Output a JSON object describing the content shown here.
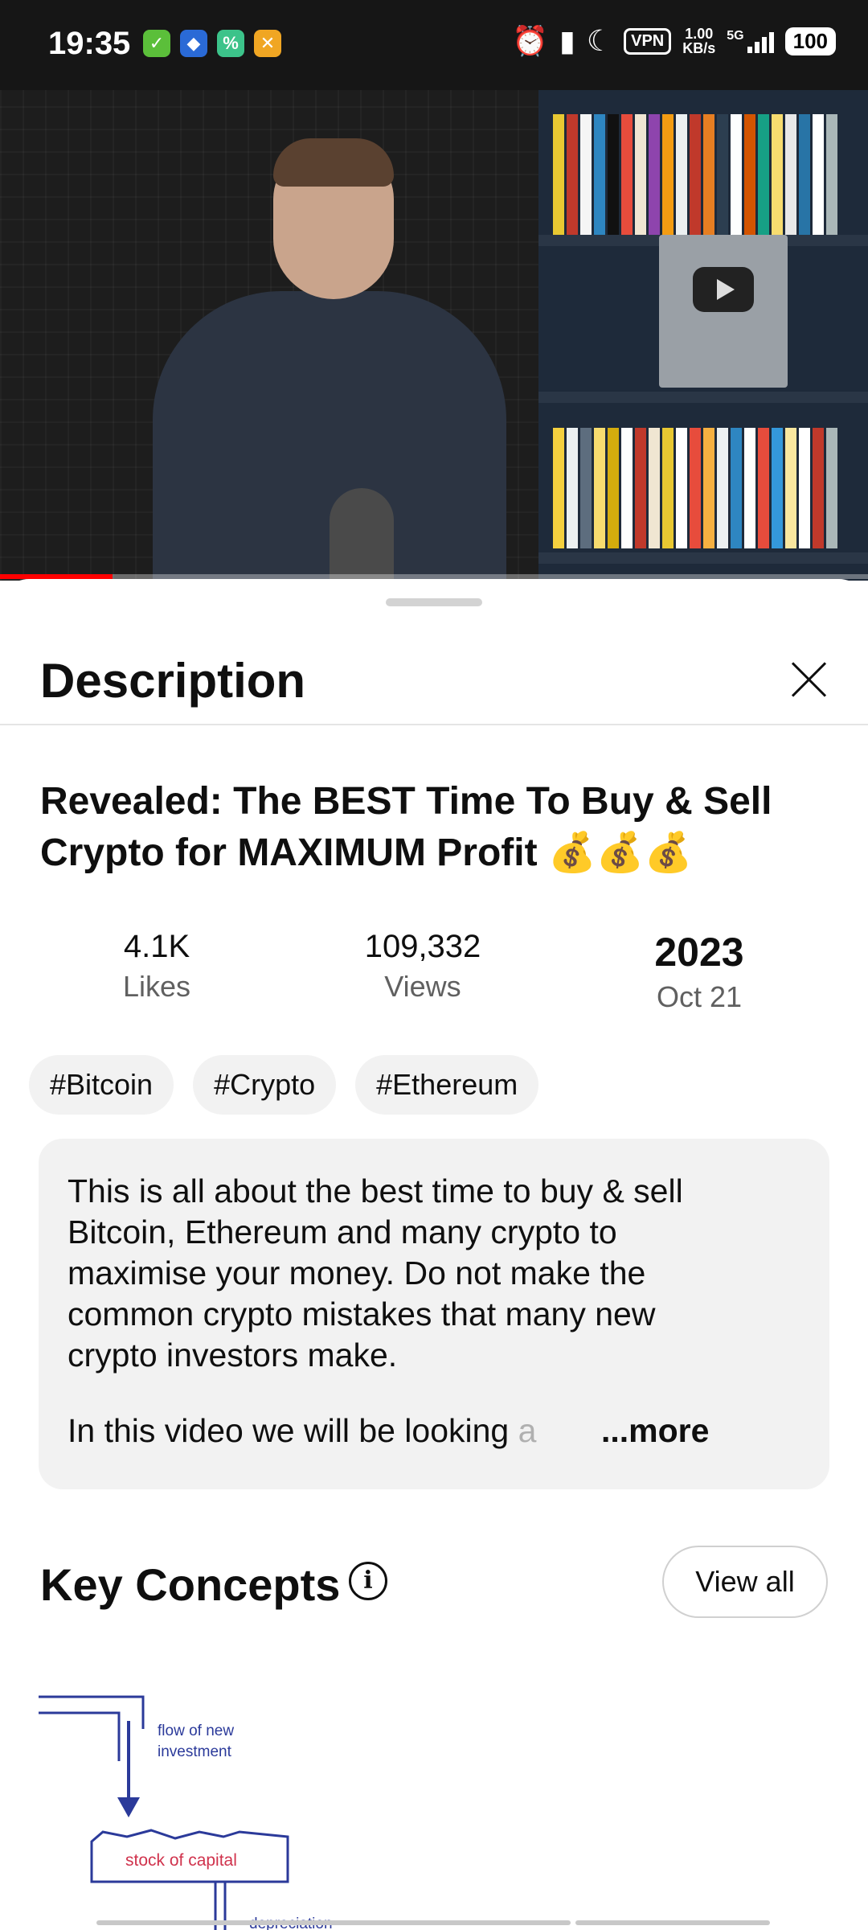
{
  "status_bar": {
    "time": "19:35",
    "vpn": "VPN",
    "speed_value": "1.00",
    "speed_unit": "KB/s",
    "network": "5G",
    "battery": "100"
  },
  "sheet": {
    "title": "Description",
    "close_icon": "close-icon"
  },
  "video": {
    "title": "Revealed: The BEST Time To Buy & Sell Crypto for MAXIMUM Profit 💰💰💰",
    "progress_fraction": 0.13,
    "stats": {
      "likes_value": "4.1K",
      "likes_label": "Likes",
      "views_value": "109,332",
      "views_label": "Views",
      "year": "2023",
      "date": "Oct 21"
    },
    "tags": [
      "#Bitcoin",
      "#Crypto",
      "#Ethereum"
    ],
    "description": "This is all about the best time to buy & sell Bitcoin, Ethereum and many crypto to maximise your money. Do not make the common crypto mistakes that many new crypto investors make.",
    "description_next_line": "In this video we will be looking a",
    "more_label": "...more"
  },
  "key_concepts": {
    "title": "Key Concepts",
    "view_all_label": "View all",
    "diagram": {
      "label_flow": "flow of new investment",
      "label_stock": "stock of capital",
      "label_depreciation": "depreciation"
    }
  },
  "colors": {
    "progress": "#ff0000",
    "chip_bg": "#f2f2f2",
    "diagram_blue": "#2b3a9a",
    "diagram_red": "#d0334d"
  }
}
